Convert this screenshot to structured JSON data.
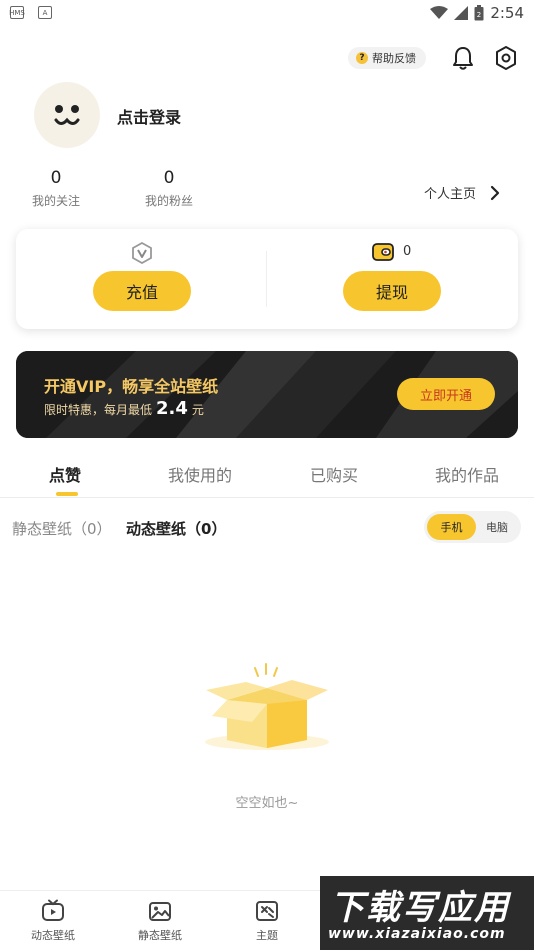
{
  "status_bar": {
    "left_icons": [
      "HMS",
      "A"
    ],
    "time": "2:54",
    "battery_level": "2"
  },
  "header": {
    "help_feedback": "帮助反馈",
    "icons": [
      "bell-icon",
      "settings-icon"
    ]
  },
  "profile": {
    "login_prompt": "点击登录",
    "stats": [
      {
        "value": "0",
        "label": "我的关注"
      },
      {
        "value": "0",
        "label": "我的粉丝"
      }
    ],
    "homepage_link": "个人主页"
  },
  "wallet": {
    "coin_balance": "0",
    "recharge_label": "充值",
    "withdraw_label": "提现"
  },
  "vip_banner": {
    "title": "开通VIP，畅享全站壁纸",
    "subtitle_prefix": "限时特惠，每月最低",
    "price": "2.4",
    "unit": "元",
    "button": "立即开通"
  },
  "tabs": [
    {
      "label": "点赞",
      "active": true
    },
    {
      "label": "我使用的",
      "active": false
    },
    {
      "label": "已购买",
      "active": false
    },
    {
      "label": "我的作品",
      "active": false
    }
  ],
  "subfilters": {
    "static": "静态壁纸（0）",
    "dynamic": "动态壁纸（0）",
    "device_options": [
      "手机",
      "电脑"
    ],
    "selected_device": "手机"
  },
  "empty_state": {
    "text": "空空如也~"
  },
  "bottom_nav": [
    {
      "label": "动态壁纸",
      "icon": "tv-icon"
    },
    {
      "label": "静态壁纸",
      "icon": "image-icon"
    },
    {
      "label": "主题",
      "icon": "theme-icon"
    }
  ],
  "watermark": {
    "text_big": "下载写应用",
    "text_small": "www.xiazaixiao.com"
  },
  "colors": {
    "accent": "#f7c62f",
    "vip_background": "#1f1f1f",
    "vip_text": "#f5c864",
    "vip_button_text": "#c9371f"
  }
}
